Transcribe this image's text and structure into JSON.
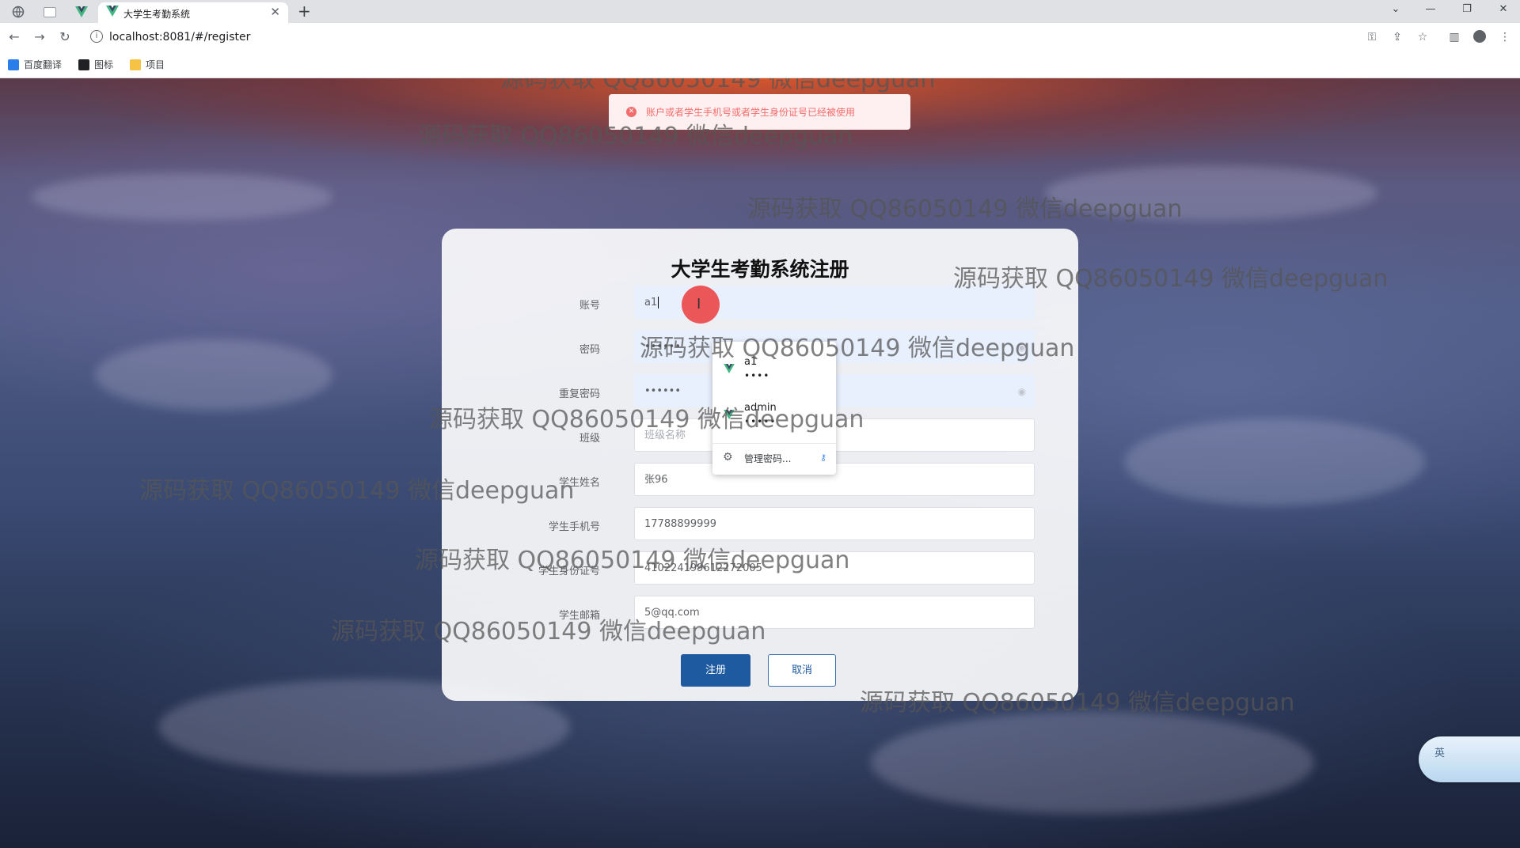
{
  "browser": {
    "tab_title": "大学生考勤系统",
    "url": "localhost:8081/#/register",
    "bookmarks": [
      {
        "label": "百度翻译",
        "icon": "translate-icon"
      },
      {
        "label": "图标",
        "icon": "image-icon"
      },
      {
        "label": "项目",
        "icon": "folder-icon"
      }
    ]
  },
  "alert": {
    "message": "账户或者学生手机号或者学生身份证号已经被使用",
    "color": "#f56c6c"
  },
  "form": {
    "title": "大学生考勤系统注册",
    "fields": [
      {
        "label": "账号",
        "value": "a1",
        "placeholder": ""
      },
      {
        "label": "密码",
        "value": "••••••",
        "placeholder": ""
      },
      {
        "label": "重复密码",
        "value": "••••••",
        "placeholder": ""
      },
      {
        "label": "班级",
        "value": "",
        "placeholder": "班级名称"
      },
      {
        "label": "学生姓名",
        "value": "张96",
        "placeholder": ""
      },
      {
        "label": "学生手机号",
        "value": "17788899999",
        "placeholder": ""
      },
      {
        "label": "学生身份证号",
        "value": "410224199612272005",
        "placeholder": ""
      },
      {
        "label": "学生邮箱",
        "value": "5@qq.com",
        "placeholder": ""
      }
    ],
    "register_label": "注册",
    "cancel_label": "取消",
    "primary_color": "#1e5aa0"
  },
  "autofill": {
    "entries": [
      {
        "user": "a1",
        "password": "••••"
      },
      {
        "user": "admin",
        "password": "•••••"
      }
    ],
    "manage_label": "管理密码..."
  },
  "ime": {
    "label": "英"
  },
  "watermark": "源码获取 QQ86050149 微信deepguan"
}
